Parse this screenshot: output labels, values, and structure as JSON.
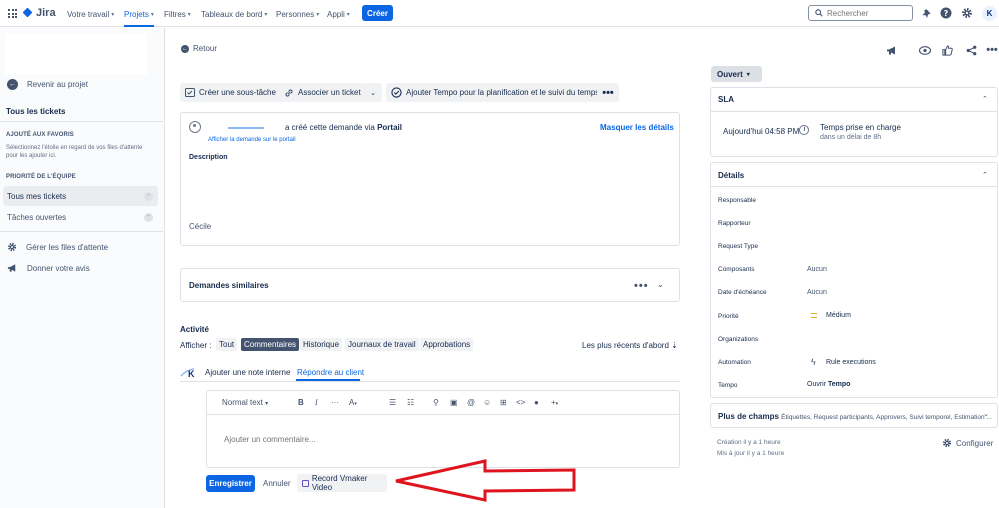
{
  "topnav": {
    "logo": "Jira",
    "items": [
      {
        "label": "Votre travail"
      },
      {
        "label": "Projets"
      },
      {
        "label": "Filtres"
      },
      {
        "label": "Tableaux de bord"
      },
      {
        "label": "Personnes"
      },
      {
        "label": "Appli"
      }
    ],
    "create_label": "Créer",
    "search_placeholder": "Rechercher",
    "avatar_letter": "K",
    "accent": "#0c66e4"
  },
  "sidebar": {
    "back_label": "Revenir au projet",
    "all_tickets": "Tous les tickets",
    "favorites_heading": "AJOUTÉ AUX FAVORIS",
    "favorites_help": "Sélectionnez l'étoile en regard de vos files d'attente pour les ajouter ici.",
    "team_heading": "PRIORITÉ DE L'ÉQUIPE",
    "queues": [
      {
        "label": "Tous mes tickets"
      },
      {
        "label": "Tâches ouvertes"
      }
    ],
    "manage_queues": "Gérer les files d'attente",
    "feedback": "Donner votre avis"
  },
  "main": {
    "back": "Retour",
    "toolbar": {
      "subtask": "Créer une sous-tâche",
      "link": "Associer un ticket",
      "tempo": "Ajouter Tempo pour la planification et le suivi du temps"
    },
    "request": {
      "created_prefix": "a créé cette demande via ",
      "created_channel": "Portail",
      "portal_link": "Afficher la demande sur le portail",
      "hide_details": "Masquer les détails",
      "description_label": "Description",
      "description_body": "Cécile"
    },
    "similar": {
      "title": "Demandes similaires"
    },
    "activity": {
      "title": "Activité",
      "show_label": "Afficher :",
      "filters": [
        {
          "label": "Tout"
        },
        {
          "label": "Commentaires"
        },
        {
          "label": "Historique"
        },
        {
          "label": "Journaux de travail"
        },
        {
          "label": "Approbations"
        }
      ],
      "sort": "Les plus récents d'abord",
      "tabs": [
        {
          "label": "Ajouter une note interne"
        },
        {
          "label": "Répondre au client"
        }
      ],
      "text_style": "Normal text",
      "comment_placeholder": "Ajouter un commentaire...",
      "save": "Enregistrer",
      "cancel": "Annuler",
      "vmaker": "Record Vmaker Video"
    }
  },
  "right": {
    "status": "Ouvert",
    "sla": {
      "title": "SLA",
      "time": "Aujourd'hui 04:58 PM",
      "label": "Temps prise en charge",
      "sub": "dans un délai de 8h"
    },
    "details": {
      "title": "Détails",
      "fields": [
        {
          "label": "Responsable",
          "value": ""
        },
        {
          "label": "Rapporteur",
          "value": ""
        },
        {
          "label": "Request Type",
          "value": ""
        },
        {
          "label": "Composants",
          "value": "Aucun"
        },
        {
          "label": "Date d'échéance",
          "value": "Aucun"
        },
        {
          "label": "Priorité",
          "value": "Médium"
        },
        {
          "label": "Organizations",
          "value": ""
        },
        {
          "label": "Automation",
          "value": "Rule executions"
        },
        {
          "label": "Tempo",
          "value_prefix": "Ouvrir ",
          "value_bold": "Tempo"
        }
      ]
    },
    "more_fields": {
      "title": "Plus de champs",
      "list": "Étiquettes, Request participants, Approvers, Suivi temporel, Estimation ..."
    },
    "created": "Création il y a 1 heure",
    "updated": "Mis à jour il y a 1 heure",
    "configure": "Configurer"
  }
}
